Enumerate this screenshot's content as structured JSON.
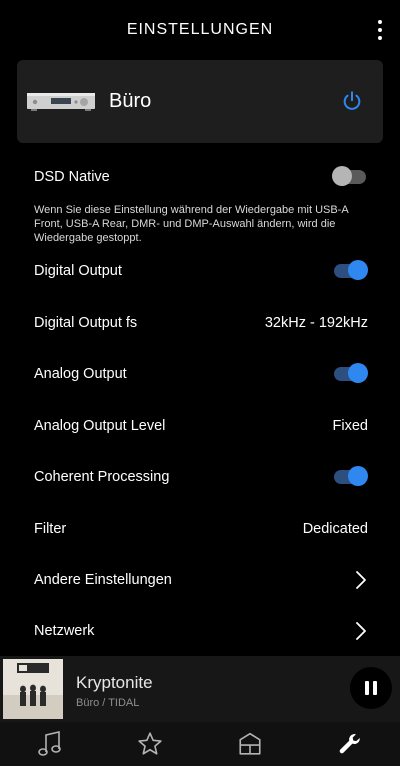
{
  "header": {
    "title": "EINSTELLUNGEN"
  },
  "device": {
    "name": "Büro"
  },
  "settings": {
    "dsd_native": {
      "label": "DSD Native",
      "on": false
    },
    "dsd_note": "Wenn Sie diese Einstellung während der Wiedergabe mit USB-A Front, USB-A Rear, DMR- und DMP-Auswahl ändern, wird die Wiedergabe gestoppt.",
    "digital_output": {
      "label": "Digital Output",
      "on": true
    },
    "digital_output_fs": {
      "label": "Digital Output fs",
      "value": "32kHz - 192kHz"
    },
    "analog_output": {
      "label": "Analog Output",
      "on": true
    },
    "analog_output_level": {
      "label": "Analog Output Level",
      "value": "Fixed"
    },
    "coherent_processing": {
      "label": "Coherent Processing",
      "on": true
    },
    "filter": {
      "label": "Filter",
      "value": "Dedicated"
    },
    "other_settings": {
      "label": "Andere Einstellungen"
    },
    "network": {
      "label": "Netzwerk"
    }
  },
  "now_playing": {
    "title": "Kryptonite",
    "subtitle": "Büro / TIDAL"
  },
  "colors": {
    "accent": "#2e88f0",
    "card_bg": "#1e1e1e",
    "background": "#000000"
  },
  "icons": {
    "more": "more-vertical-icon",
    "power": "power-icon",
    "chevron": "chevron-right-icon",
    "pause": "pause-icon",
    "nav": [
      "music-note-icon",
      "star-icon",
      "home-icon",
      "wrench-icon"
    ]
  }
}
